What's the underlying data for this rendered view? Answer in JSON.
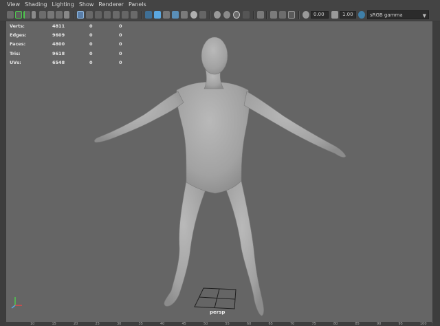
{
  "menu": [
    "View",
    "Shading",
    "Lighting",
    "Show",
    "Renderer",
    "Panels"
  ],
  "toolbar": {
    "exposure_value": "0.00",
    "gamma_value": "1.00",
    "color_space": "sRGB gamma"
  },
  "hud": {
    "rows": [
      {
        "label": "Verts:",
        "v1": "4811",
        "v2": "0",
        "v3": "0"
      },
      {
        "label": "Edges:",
        "v1": "9609",
        "v2": "0",
        "v3": "0"
      },
      {
        "label": "Faces:",
        "v1": "4800",
        "v2": "0",
        "v3": "0"
      },
      {
        "label": "Tris:",
        "v1": "9618",
        "v2": "0",
        "v3": "0"
      },
      {
        "label": "UVs:",
        "v1": "6548",
        "v2": "0",
        "v3": "0"
      }
    ]
  },
  "camera_label": "persp",
  "timeline_ticks": [
    "10",
    "15",
    "20",
    "25",
    "30",
    "35",
    "40",
    "45",
    "50",
    "55",
    "60",
    "65",
    "70",
    "75",
    "80",
    "85",
    "90",
    "95",
    "100"
  ],
  "axis": {
    "x": "x",
    "y": "y",
    "z": "z"
  },
  "colors": {
    "viewport_bg": "#656565",
    "mesh": "#a8a8a8",
    "accent_green": "#4ec94e",
    "accent_blue": "#5aa7e0"
  }
}
